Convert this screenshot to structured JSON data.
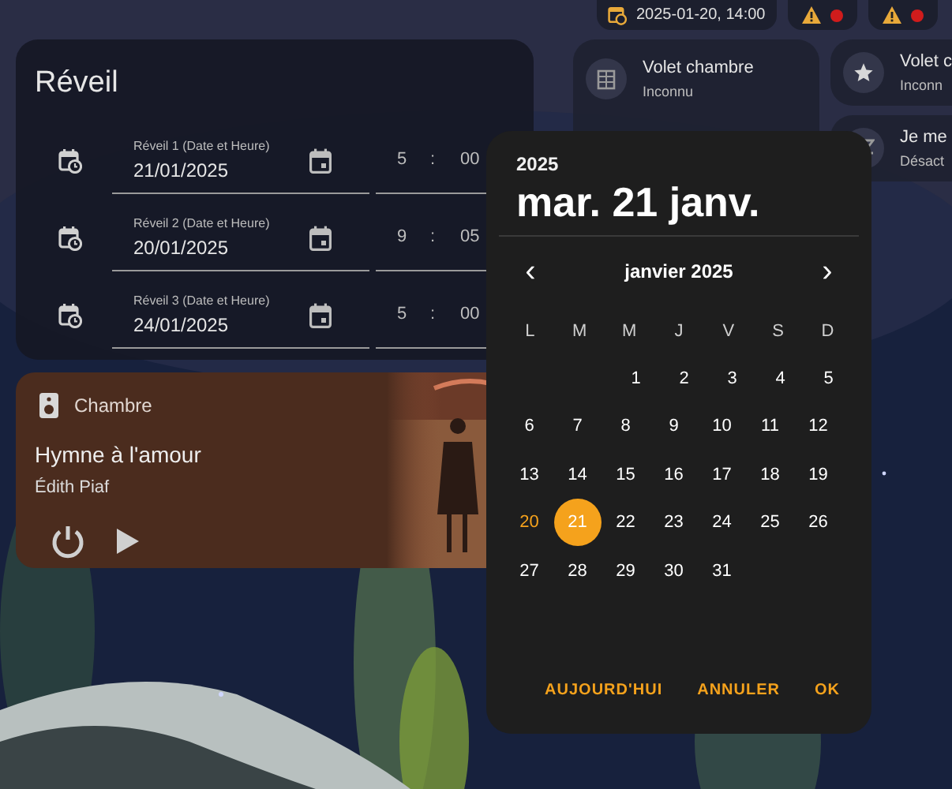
{
  "status_chips": [
    {
      "kind": "time",
      "text": "2025-01-20, 14:00"
    },
    {
      "kind": "warning"
    },
    {
      "kind": "warning"
    }
  ],
  "alarm_card": {
    "title": "Réveil",
    "alarms": [
      {
        "label": "Réveil 1 (Date et Heure)",
        "date": "21/01/2025",
        "hour": "5",
        "separator": ":",
        "minute": "00"
      },
      {
        "label": "Réveil 2 (Date et Heure)",
        "date": "20/01/2025",
        "hour": "9",
        "separator": ":",
        "minute": "05"
      },
      {
        "label": "Réveil 3 (Date et Heure)",
        "date": "24/01/2025",
        "hour": "5",
        "separator": ":",
        "minute": "00"
      }
    ]
  },
  "media_card": {
    "room": "Chambre",
    "track": "Hymne à l'amour",
    "artist": "Édith Piaf"
  },
  "entity_cards": [
    {
      "kind": "shutter",
      "name": "Volet chambre",
      "state": "Inconnu"
    },
    {
      "kind": "star",
      "name": "Volet c",
      "state": "Inconn"
    },
    {
      "kind": "sleep",
      "name": "Je me",
      "state": "Désact"
    }
  ],
  "date_picker": {
    "year": "2025",
    "headline": "mar. 21 janv.",
    "month": "janvier 2025",
    "prev": "‹",
    "next": "›",
    "weekdays": [
      "L",
      "M",
      "M",
      "J",
      "V",
      "S",
      "D"
    ],
    "weeks": [
      [
        {
          "day": "1",
          "selected": false,
          "today": false
        },
        {
          "day": "2",
          "selected": false,
          "today": false
        },
        {
          "day": "3",
          "selected": false,
          "today": false
        },
        {
          "day": "4",
          "selected": false,
          "today": false
        },
        {
          "day": "5",
          "selected": false,
          "today": false
        }
      ],
      [
        {
          "day": "6",
          "selected": false,
          "today": false
        },
        {
          "day": "7",
          "selected": false,
          "today": false
        },
        {
          "day": "8",
          "selected": false,
          "today": false
        },
        {
          "day": "9",
          "selected": false,
          "today": false
        },
        {
          "day": "10",
          "selected": false,
          "today": false
        },
        {
          "day": "11",
          "selected": false,
          "today": false
        },
        {
          "day": "12",
          "selected": false,
          "today": false
        }
      ],
      [
        {
          "day": "13",
          "selected": false,
          "today": false
        },
        {
          "day": "14",
          "selected": false,
          "today": false
        },
        {
          "day": "15",
          "selected": false,
          "today": false
        },
        {
          "day": "16",
          "selected": false,
          "today": false
        },
        {
          "day": "17",
          "selected": false,
          "today": false
        },
        {
          "day": "18",
          "selected": false,
          "today": false
        },
        {
          "day": "19",
          "selected": false,
          "today": false
        }
      ],
      [
        {
          "day": "20",
          "selected": false,
          "today": true
        },
        {
          "day": "21",
          "selected": true,
          "today": false
        },
        {
          "day": "22",
          "selected": false,
          "today": false
        },
        {
          "day": "23",
          "selected": false,
          "today": false
        },
        {
          "day": "24",
          "selected": false,
          "today": false
        },
        {
          "day": "25",
          "selected": false,
          "today": false
        },
        {
          "day": "26",
          "selected": false,
          "today": false
        }
      ],
      [
        {
          "day": "27",
          "selected": false,
          "today": false
        },
        {
          "day": "28",
          "selected": false,
          "today": false
        },
        {
          "day": "29",
          "selected": false,
          "today": false
        },
        {
          "day": "30",
          "selected": false,
          "today": false
        },
        {
          "day": "31",
          "selected": false,
          "today": false
        }
      ]
    ],
    "buttons": [
      "AUJOURD'HUI",
      "ANNULER",
      "OK"
    ]
  }
}
